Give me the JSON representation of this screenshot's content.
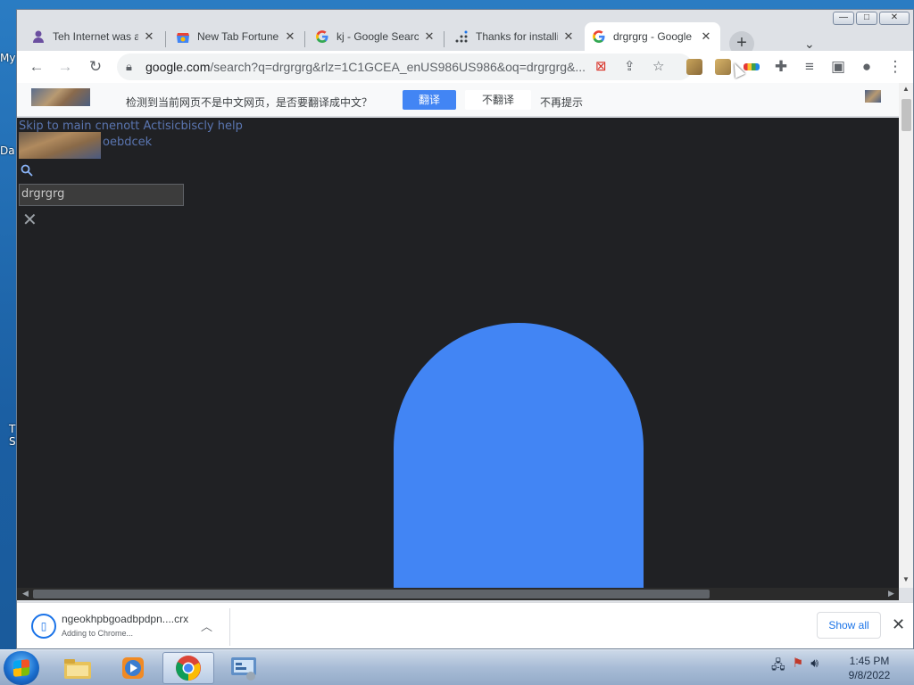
{
  "desktop": {
    "labels": [
      "My",
      "Da",
      "T",
      "S"
    ]
  },
  "window": {
    "controls": {
      "minimize": "—",
      "maximize": "□",
      "close": "✕"
    }
  },
  "tabs": [
    {
      "title": "Teh Internet was a",
      "icon": "user-avatar-icon"
    },
    {
      "title": "New Tab Fortune",
      "icon": "chrome-web-store-icon"
    },
    {
      "title": "kj - Google Search",
      "icon": "google-g-icon"
    },
    {
      "title": "Thanks for installin",
      "icon": "dots-grid-icon"
    },
    {
      "title": "drgrgrg - Google S",
      "icon": "google-g-icon",
      "active": true
    }
  ],
  "toolbar": {
    "url_host": "google.com",
    "url_rest": "/search?q=drgrgrg&rlz=1C1GCEA_enUS986US986&oq=drgrgrg&..."
  },
  "translate_bar": {
    "message": "检测到当前网页不是中文网页，是否要翻译成中文？",
    "translate_label": "翻译",
    "dont_translate_label": "不翻译",
    "never_label": "不再提示"
  },
  "page": {
    "skip_link": "Skip to main cnenott Actisicbiscly help",
    "logo_alt": "oebdcek",
    "search_value": "drgrgrg",
    "accent_color": "#4285f4",
    "background_color": "#202124"
  },
  "download": {
    "file_name": "ngeokhpbgoadbpdpn....crx",
    "status": "Adding to Chrome...",
    "show_all_label": "Show all"
  },
  "taskbar": {
    "time": "1:45 PM",
    "date": "9/8/2022",
    "apps": [
      "windows-explorer-icon",
      "media-player-icon",
      "chrome-icon",
      "control-panel-icon"
    ]
  }
}
